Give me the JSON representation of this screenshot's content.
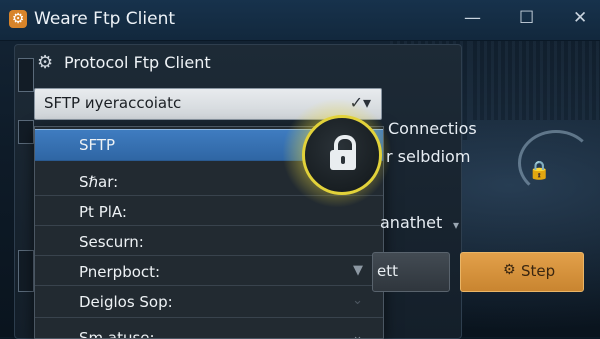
{
  "window": {
    "title": "Weare Ftp Client",
    "icon": "gear-icon",
    "controls": [
      "—",
      "☐",
      "✕"
    ]
  },
  "section": {
    "label": "Protocol Ftp Client",
    "icon": "gear-icon"
  },
  "protocol_select": {
    "value": "SFTP  иуeraccoiatc",
    "arrow_icon": "chevron-down-icon"
  },
  "dropdown": {
    "options": [
      {
        "label": "SFTP",
        "selected": true
      },
      {
        "label": "Sℏar:",
        "selected": false
      },
      {
        "label": "Pt PlA:",
        "selected": false
      },
      {
        "label": "Sescurn:",
        "selected": false
      },
      {
        "label": "Pnerpboct:",
        "selected": false
      },
      {
        "label": "Deiglos Sop:",
        "selected": false
      },
      {
        "label": "Sm atuse:",
        "selected": false
      }
    ]
  },
  "overlay": {
    "lock_icon": "lock-icon",
    "highlight_color": "#e2d23a"
  },
  "right_panel": {
    "line1": "Connectios",
    "line2": "r selbdiom",
    "line3": "anathet",
    "caret": "▾"
  },
  "buttons": {
    "left_label": "ett",
    "step_label": "Step",
    "step_icon": "gear-icon"
  },
  "colors": {
    "accent_selected": "#3f7cc0",
    "step_button": "#d4923c"
  }
}
